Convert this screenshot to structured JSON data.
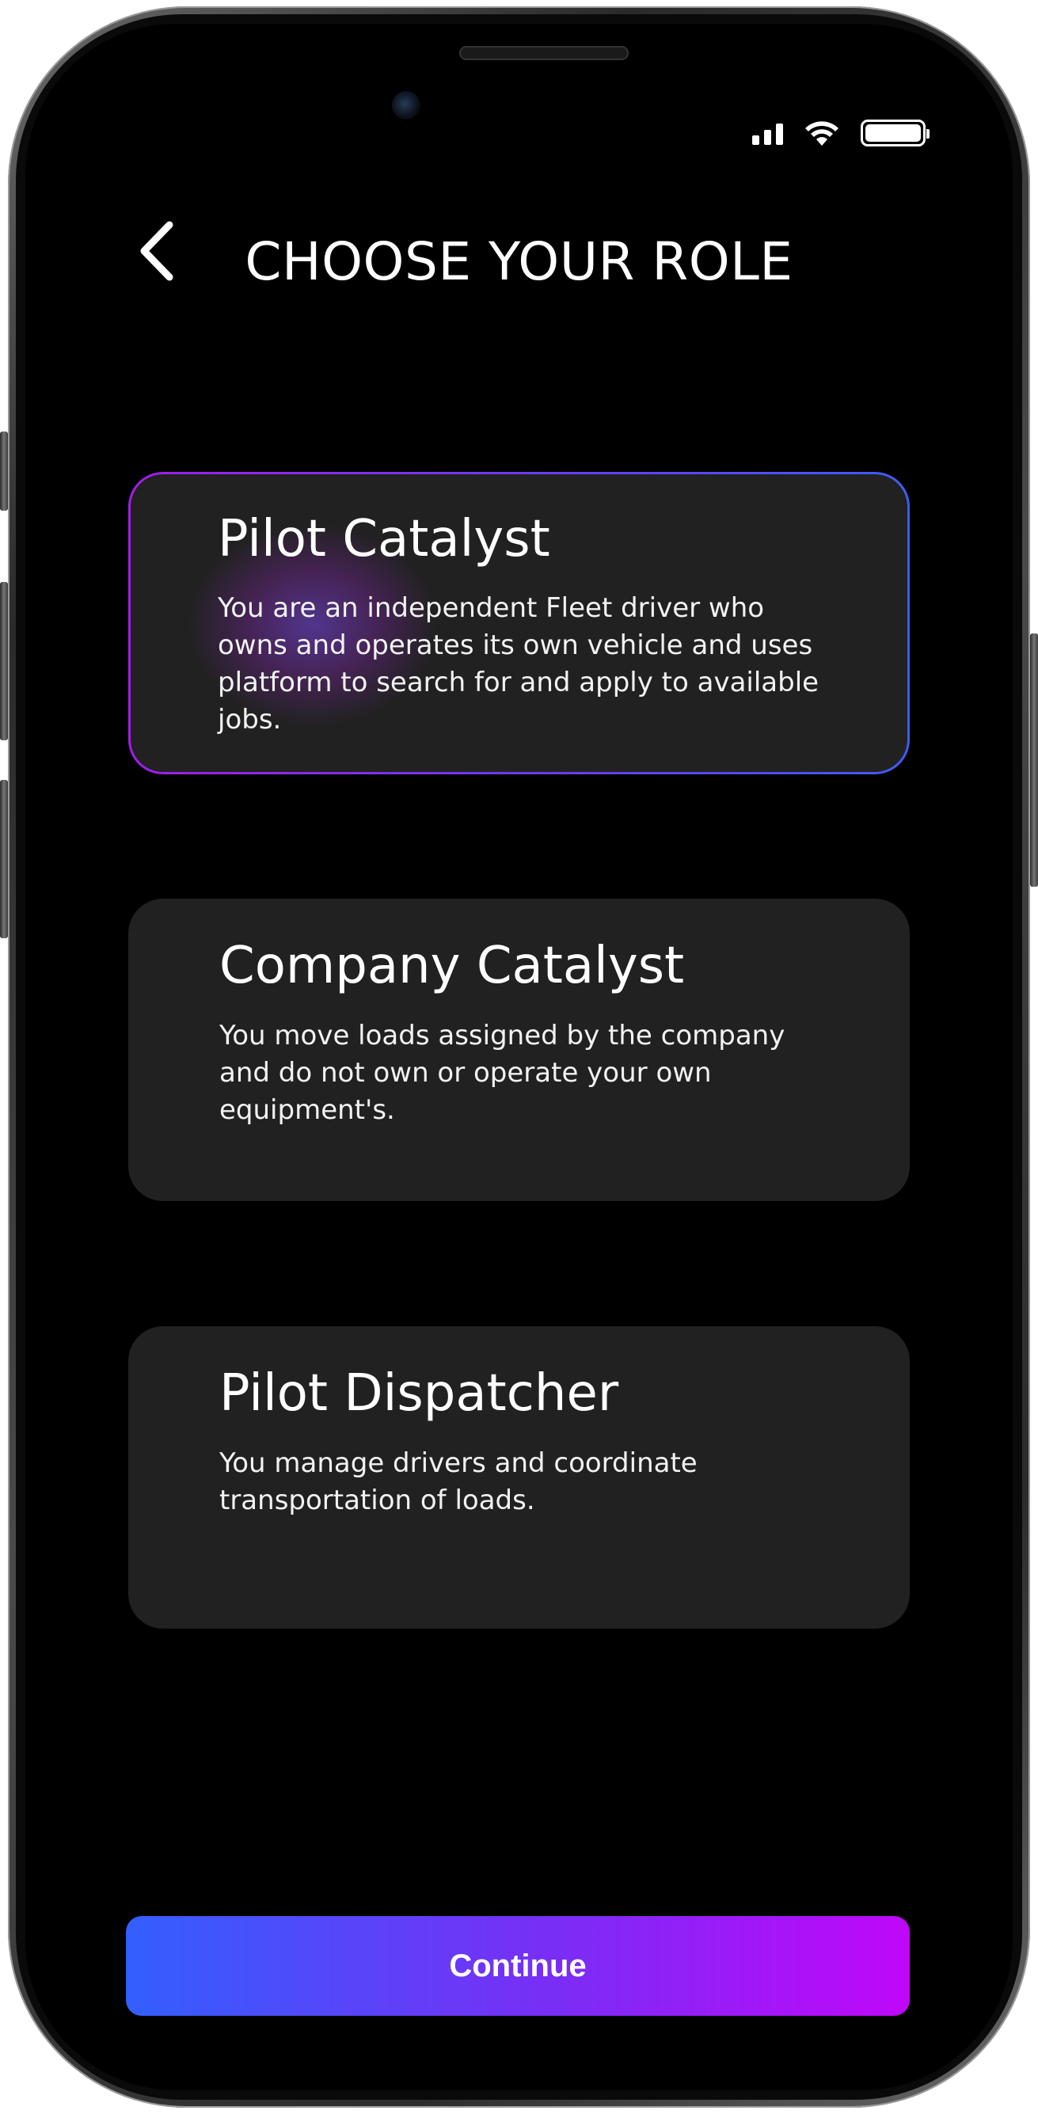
{
  "status_bar": {
    "signal_icon": "cellular-signal-icon",
    "wifi_icon": "wifi-icon",
    "battery_icon": "battery-icon"
  },
  "header": {
    "back_icon": "chevron-left-icon",
    "title": "CHOOSE YOUR ROLE"
  },
  "roles": [
    {
      "title": "Pilot Catalyst",
      "description": "You are an independent Fleet driver who owns and operates its own vehicle and uses platform to search for and apply to available jobs.",
      "selected": true
    },
    {
      "title": "Company Catalyst",
      "description": "You move loads assigned by the company and do not own or operate your own equipment's.",
      "selected": false
    },
    {
      "title": "Pilot Dispatcher",
      "description": "You manage drivers and coordinate transportation of loads.",
      "selected": false
    }
  ],
  "continue_label": "Continue",
  "colors": {
    "background": "#000000",
    "card": "#212121",
    "accent_blue": "#335ffd",
    "accent_purple": "#c007fa"
  }
}
